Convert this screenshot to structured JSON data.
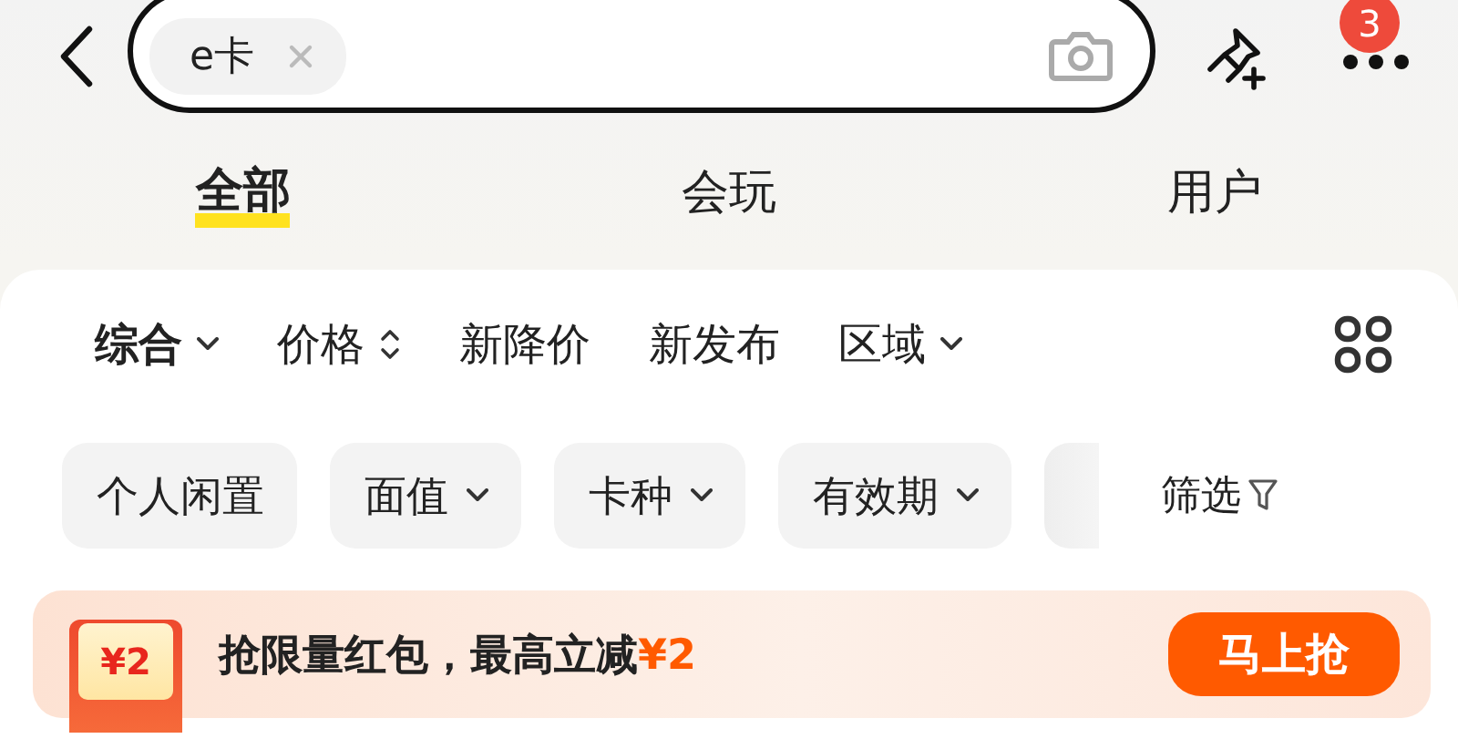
{
  "search": {
    "chips": [
      {
        "label": "e卡"
      }
    ]
  },
  "more_badge": "3",
  "tabs": [
    {
      "label": "全部",
      "selected": true
    },
    {
      "label": "会玩",
      "selected": false
    },
    {
      "label": "用户",
      "selected": false
    }
  ],
  "sorts": [
    {
      "label": "综合",
      "kind": "dropdown",
      "selected": true
    },
    {
      "label": "价格",
      "kind": "sort",
      "selected": false
    },
    {
      "label": "新降价",
      "kind": "plain",
      "selected": false
    },
    {
      "label": "新发布",
      "kind": "plain",
      "selected": false
    },
    {
      "label": "区域",
      "kind": "dropdown",
      "selected": false
    }
  ],
  "filters": [
    {
      "label": "个人闲置",
      "kind": "plain"
    },
    {
      "label": "面值",
      "kind": "dropdown"
    },
    {
      "label": "卡种",
      "kind": "dropdown"
    },
    {
      "label": "有效期",
      "kind": "dropdown"
    },
    {
      "kind": "faded"
    }
  ],
  "filter_button": "筛选",
  "banner": {
    "amount": "¥2",
    "text": "抢限量红包，最高立减**¥2**",
    "button": "马上抢"
  }
}
